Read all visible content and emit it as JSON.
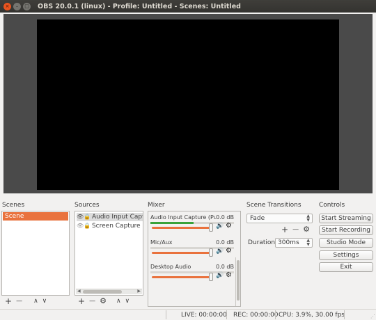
{
  "window": {
    "title": "OBS 20.0.1 (linux) - Profile: Untitled - Scenes: Untitled",
    "controls": {
      "close": "×",
      "minimize": "–",
      "maximize": "□"
    }
  },
  "scenes": {
    "title": "Scenes",
    "items": [
      {
        "label": "Scene",
        "selected": true
      }
    ],
    "toolbar": {
      "add": "+",
      "remove": "—",
      "up": "∧",
      "down": "∨"
    }
  },
  "sources": {
    "title": "Sources",
    "items": [
      {
        "label": "Audio Input Capture",
        "visible_icon": "eye-icon",
        "lock_icon": "lock-icon",
        "visible": true
      },
      {
        "label": "Screen Capture (XSHM)",
        "visible_icon": "eye-hidden-icon",
        "lock_icon": "lock-icon",
        "visible": false
      }
    ],
    "toolbar": {
      "add": "+",
      "remove": "—",
      "settings": "⚙",
      "up": "∧",
      "down": "∨"
    }
  },
  "mixer": {
    "title": "Mixer",
    "channels": [
      {
        "name": "Audio Input Capture (PulseAudio)",
        "db": "0.0 dB",
        "volume": 1.0,
        "meter_level": 0.52
      },
      {
        "name": "Mic/Aux",
        "db": "0.0 dB",
        "volume": 1.0,
        "meter_level": 0.0
      },
      {
        "name": "Desktop Audio",
        "db": "0.0 dB",
        "volume": 1.0,
        "meter_level": 0.0
      }
    ],
    "volume_icon": "🔊",
    "gear_icon": "⚙"
  },
  "transitions": {
    "title": "Scene Transitions",
    "selected": "Fade",
    "add": "+",
    "remove": "—",
    "settings": "⚙",
    "duration_label": "Duration",
    "duration_value": "300ms"
  },
  "controls": {
    "title": "Controls",
    "buttons": [
      "Start Streaming",
      "Start Recording",
      "Studio Mode",
      "Settings",
      "Exit"
    ]
  },
  "status": {
    "live": "LIVE: 00:00:00",
    "rec": "REC: 00:00:00",
    "cpu": "CPU: 3.9%, 30.00 fps"
  },
  "colors": {
    "accent": "#e9723d",
    "titlebar": "#3c3b37",
    "preview_bg": "#4a4a4a",
    "canvas": "#000000",
    "meter": "#3aa23a"
  }
}
